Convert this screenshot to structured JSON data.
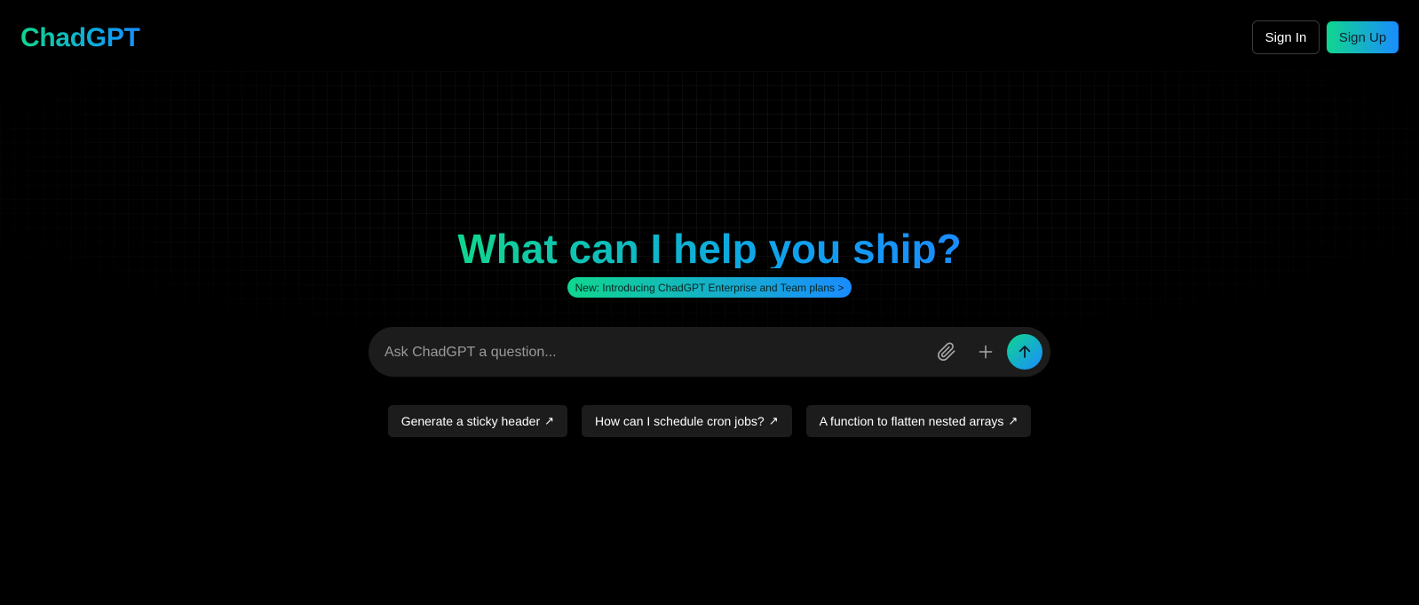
{
  "header": {
    "logo": "ChadGPT",
    "sign_in_label": "Sign In",
    "sign_up_label": "Sign Up"
  },
  "hero": {
    "title": "What can I help you ship?",
    "announcement": "New: Introducing ChadGPT Enterprise and Team plans >"
  },
  "search": {
    "placeholder": "Ask ChadGPT a question...",
    "value": "",
    "attach_icon": "paperclip-icon",
    "add_icon": "plus-icon",
    "send_icon": "arrow-up-icon"
  },
  "suggestions": [
    {
      "label": "Generate a sticky header",
      "arrow": "↗"
    },
    {
      "label": "How can I schedule cron jobs?",
      "arrow": "↗"
    },
    {
      "label": "A function to flatten nested arrays",
      "arrow": "↗"
    }
  ],
  "colors": {
    "background": "#000000",
    "accent_start": "#10d68e",
    "accent_end": "#1a8cff",
    "surface": "#1c1c1c"
  }
}
